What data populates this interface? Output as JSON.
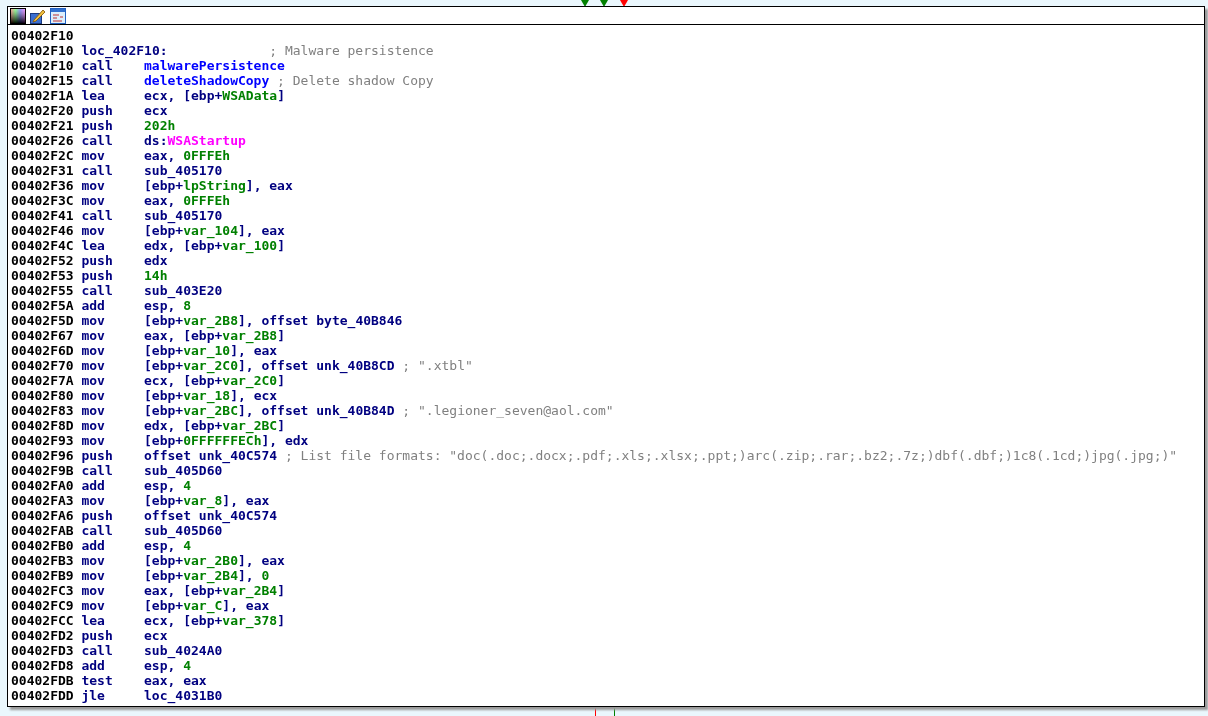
{
  "node": {
    "lines": [
      {
        "kind": "blank",
        "address": "00402F10"
      },
      {
        "kind": "label",
        "address": "00402F10",
        "label": "loc_402F10:",
        "comment": "; Malware persistence"
      },
      {
        "kind": "instruction",
        "address": "00402F10",
        "mnemonic": "call",
        "operands": [
          {
            "text": "malwarePersistence",
            "kind": "name"
          }
        ]
      },
      {
        "kind": "instruction",
        "address": "00402F15",
        "mnemonic": "call",
        "operands": [
          {
            "text": "deleteShadowCopy",
            "kind": "name"
          }
        ],
        "comment": "; Delete shadow Copy"
      },
      {
        "kind": "instruction",
        "address": "00402F1A",
        "mnemonic": "lea",
        "operands": [
          {
            "text": "ecx, [ebp+",
            "kind": "plain"
          },
          {
            "text": "WSAData",
            "kind": "var"
          },
          {
            "text": "]",
            "kind": "plain"
          }
        ]
      },
      {
        "kind": "instruction",
        "address": "00402F20",
        "mnemonic": "push",
        "operands": [
          {
            "text": "ecx",
            "kind": "plain"
          }
        ]
      },
      {
        "kind": "instruction",
        "address": "00402F21",
        "mnemonic": "push",
        "operands": [
          {
            "text": "202h",
            "kind": "number"
          }
        ]
      },
      {
        "kind": "instruction",
        "address": "00402F26",
        "mnemonic": "call",
        "operands": [
          {
            "text": "ds:",
            "kind": "plain"
          },
          {
            "text": "WSAStartup",
            "kind": "import"
          }
        ]
      },
      {
        "kind": "instruction",
        "address": "00402F2C",
        "mnemonic": "mov",
        "operands": [
          {
            "text": "eax, ",
            "kind": "plain"
          },
          {
            "text": "0FFFEh",
            "kind": "number"
          }
        ]
      },
      {
        "kind": "instruction",
        "address": "00402F31",
        "mnemonic": "call",
        "operands": [
          {
            "text": "sub_405170",
            "kind": "plain"
          }
        ]
      },
      {
        "kind": "instruction",
        "address": "00402F36",
        "mnemonic": "mov",
        "operands": [
          {
            "text": "[ebp+",
            "kind": "plain"
          },
          {
            "text": "lpString",
            "kind": "var"
          },
          {
            "text": "], eax",
            "kind": "plain"
          }
        ]
      },
      {
        "kind": "instruction",
        "address": "00402F3C",
        "mnemonic": "mov",
        "operands": [
          {
            "text": "eax, ",
            "kind": "plain"
          },
          {
            "text": "0FFFEh",
            "kind": "number"
          }
        ]
      },
      {
        "kind": "instruction",
        "address": "00402F41",
        "mnemonic": "call",
        "operands": [
          {
            "text": "sub_405170",
            "kind": "plain"
          }
        ]
      },
      {
        "kind": "instruction",
        "address": "00402F46",
        "mnemonic": "mov",
        "operands": [
          {
            "text": "[ebp+",
            "kind": "plain"
          },
          {
            "text": "var_104",
            "kind": "var"
          },
          {
            "text": "], eax",
            "kind": "plain"
          }
        ]
      },
      {
        "kind": "instruction",
        "address": "00402F4C",
        "mnemonic": "lea",
        "operands": [
          {
            "text": "edx, [ebp+",
            "kind": "plain"
          },
          {
            "text": "var_100",
            "kind": "var"
          },
          {
            "text": "]",
            "kind": "plain"
          }
        ]
      },
      {
        "kind": "instruction",
        "address": "00402F52",
        "mnemonic": "push",
        "operands": [
          {
            "text": "edx",
            "kind": "plain"
          }
        ]
      },
      {
        "kind": "instruction",
        "address": "00402F53",
        "mnemonic": "push",
        "operands": [
          {
            "text": "14h",
            "kind": "number"
          }
        ]
      },
      {
        "kind": "instruction",
        "address": "00402F55",
        "mnemonic": "call",
        "operands": [
          {
            "text": "sub_403E20",
            "kind": "plain"
          }
        ]
      },
      {
        "kind": "instruction",
        "address": "00402F5A",
        "mnemonic": "add",
        "operands": [
          {
            "text": "esp, ",
            "kind": "plain"
          },
          {
            "text": "8",
            "kind": "number"
          }
        ]
      },
      {
        "kind": "instruction",
        "address": "00402F5D",
        "mnemonic": "mov",
        "operands": [
          {
            "text": "[ebp+",
            "kind": "plain"
          },
          {
            "text": "var_2B8",
            "kind": "var"
          },
          {
            "text": "], offset byte_40B846",
            "kind": "plain"
          }
        ]
      },
      {
        "kind": "instruction",
        "address": "00402F67",
        "mnemonic": "mov",
        "operands": [
          {
            "text": "eax, [ebp+",
            "kind": "plain"
          },
          {
            "text": "var_2B8",
            "kind": "var"
          },
          {
            "text": "]",
            "kind": "plain"
          }
        ]
      },
      {
        "kind": "instruction",
        "address": "00402F6D",
        "mnemonic": "mov",
        "operands": [
          {
            "text": "[ebp+",
            "kind": "plain"
          },
          {
            "text": "var_10",
            "kind": "var"
          },
          {
            "text": "], eax",
            "kind": "plain"
          }
        ]
      },
      {
        "kind": "instruction",
        "address": "00402F70",
        "mnemonic": "mov",
        "operands": [
          {
            "text": "[ebp+",
            "kind": "plain"
          },
          {
            "text": "var_2C0",
            "kind": "var"
          },
          {
            "text": "], offset unk_40B8CD",
            "kind": "plain"
          }
        ],
        "comment": "; \".xtbl\""
      },
      {
        "kind": "instruction",
        "address": "00402F7A",
        "mnemonic": "mov",
        "operands": [
          {
            "text": "ecx, [ebp+",
            "kind": "plain"
          },
          {
            "text": "var_2C0",
            "kind": "var"
          },
          {
            "text": "]",
            "kind": "plain"
          }
        ]
      },
      {
        "kind": "instruction",
        "address": "00402F80",
        "mnemonic": "mov",
        "operands": [
          {
            "text": "[ebp+",
            "kind": "plain"
          },
          {
            "text": "var_18",
            "kind": "var"
          },
          {
            "text": "], ecx",
            "kind": "plain"
          }
        ]
      },
      {
        "kind": "instruction",
        "address": "00402F83",
        "mnemonic": "mov",
        "operands": [
          {
            "text": "[ebp+",
            "kind": "plain"
          },
          {
            "text": "var_2BC",
            "kind": "var"
          },
          {
            "text": "], offset unk_40B84D",
            "kind": "plain"
          }
        ],
        "comment": "; \".legioner_seven@aol.com\""
      },
      {
        "kind": "instruction",
        "address": "00402F8D",
        "mnemonic": "mov",
        "operands": [
          {
            "text": "edx, [ebp+",
            "kind": "plain"
          },
          {
            "text": "var_2BC",
            "kind": "var"
          },
          {
            "text": "]",
            "kind": "plain"
          }
        ]
      },
      {
        "kind": "instruction",
        "address": "00402F93",
        "mnemonic": "mov",
        "operands": [
          {
            "text": "[ebp+",
            "kind": "plain"
          },
          {
            "text": "0FFFFFFECh",
            "kind": "number"
          },
          {
            "text": "], edx",
            "kind": "plain"
          }
        ]
      },
      {
        "kind": "instruction",
        "address": "00402F96",
        "mnemonic": "push",
        "operands": [
          {
            "text": "offset unk_40C574",
            "kind": "plain"
          }
        ],
        "comment": "; List file formats: \"doc(.doc;.docx;.pdf;.xls;.xlsx;.ppt;)arc(.zip;.rar;.bz2;.7z;)dbf(.dbf;)1c8(.1cd;)jpg(.jpg;)\""
      },
      {
        "kind": "instruction",
        "address": "00402F9B",
        "mnemonic": "call",
        "operands": [
          {
            "text": "sub_405D60",
            "kind": "plain"
          }
        ]
      },
      {
        "kind": "instruction",
        "address": "00402FA0",
        "mnemonic": "add",
        "operands": [
          {
            "text": "esp, ",
            "kind": "plain"
          },
          {
            "text": "4",
            "kind": "number"
          }
        ]
      },
      {
        "kind": "instruction",
        "address": "00402FA3",
        "mnemonic": "mov",
        "operands": [
          {
            "text": "[ebp+",
            "kind": "plain"
          },
          {
            "text": "var_8",
            "kind": "var"
          },
          {
            "text": "], eax",
            "kind": "plain"
          }
        ]
      },
      {
        "kind": "instruction",
        "address": "00402FA6",
        "mnemonic": "push",
        "operands": [
          {
            "text": "offset unk_40C574",
            "kind": "plain"
          }
        ]
      },
      {
        "kind": "instruction",
        "address": "00402FAB",
        "mnemonic": "call",
        "operands": [
          {
            "text": "sub_405D60",
            "kind": "plain"
          }
        ]
      },
      {
        "kind": "instruction",
        "address": "00402FB0",
        "mnemonic": "add",
        "operands": [
          {
            "text": "esp, ",
            "kind": "plain"
          },
          {
            "text": "4",
            "kind": "number"
          }
        ]
      },
      {
        "kind": "instruction",
        "address": "00402FB3",
        "mnemonic": "mov",
        "operands": [
          {
            "text": "[ebp+",
            "kind": "plain"
          },
          {
            "text": "var_2B0",
            "kind": "var"
          },
          {
            "text": "], eax",
            "kind": "plain"
          }
        ]
      },
      {
        "kind": "instruction",
        "address": "00402FB9",
        "mnemonic": "mov",
        "operands": [
          {
            "text": "[ebp+",
            "kind": "plain"
          },
          {
            "text": "var_2B4",
            "kind": "var"
          },
          {
            "text": "], ",
            "kind": "plain"
          },
          {
            "text": "0",
            "kind": "number"
          }
        ]
      },
      {
        "kind": "instruction",
        "address": "00402FC3",
        "mnemonic": "mov",
        "operands": [
          {
            "text": "eax, [ebp+",
            "kind": "plain"
          },
          {
            "text": "var_2B4",
            "kind": "var"
          },
          {
            "text": "]",
            "kind": "plain"
          }
        ]
      },
      {
        "kind": "instruction",
        "address": "00402FC9",
        "mnemonic": "mov",
        "operands": [
          {
            "text": "[ebp+",
            "kind": "plain"
          },
          {
            "text": "var_C",
            "kind": "var"
          },
          {
            "text": "], eax",
            "kind": "plain"
          }
        ]
      },
      {
        "kind": "instruction",
        "address": "00402FCC",
        "mnemonic": "lea",
        "operands": [
          {
            "text": "ecx, [ebp+",
            "kind": "plain"
          },
          {
            "text": "var_378",
            "kind": "var"
          },
          {
            "text": "]",
            "kind": "plain"
          }
        ]
      },
      {
        "kind": "instruction",
        "address": "00402FD2",
        "mnemonic": "push",
        "operands": [
          {
            "text": "ecx",
            "kind": "plain"
          }
        ]
      },
      {
        "kind": "instruction",
        "address": "00402FD3",
        "mnemonic": "call",
        "operands": [
          {
            "text": "sub_4024A0",
            "kind": "plain"
          }
        ]
      },
      {
        "kind": "instruction",
        "address": "00402FD8",
        "mnemonic": "add",
        "operands": [
          {
            "text": "esp, ",
            "kind": "plain"
          },
          {
            "text": "4",
            "kind": "number"
          }
        ]
      },
      {
        "kind": "instruction",
        "address": "00402FDB",
        "mnemonic": "test",
        "operands": [
          {
            "text": "eax, eax",
            "kind": "plain"
          }
        ]
      },
      {
        "kind": "instruction",
        "address": "00402FDD",
        "mnemonic": "jle",
        "operands": [
          {
            "text": "loc_4031B0",
            "kind": "plain"
          }
        ]
      }
    ]
  }
}
